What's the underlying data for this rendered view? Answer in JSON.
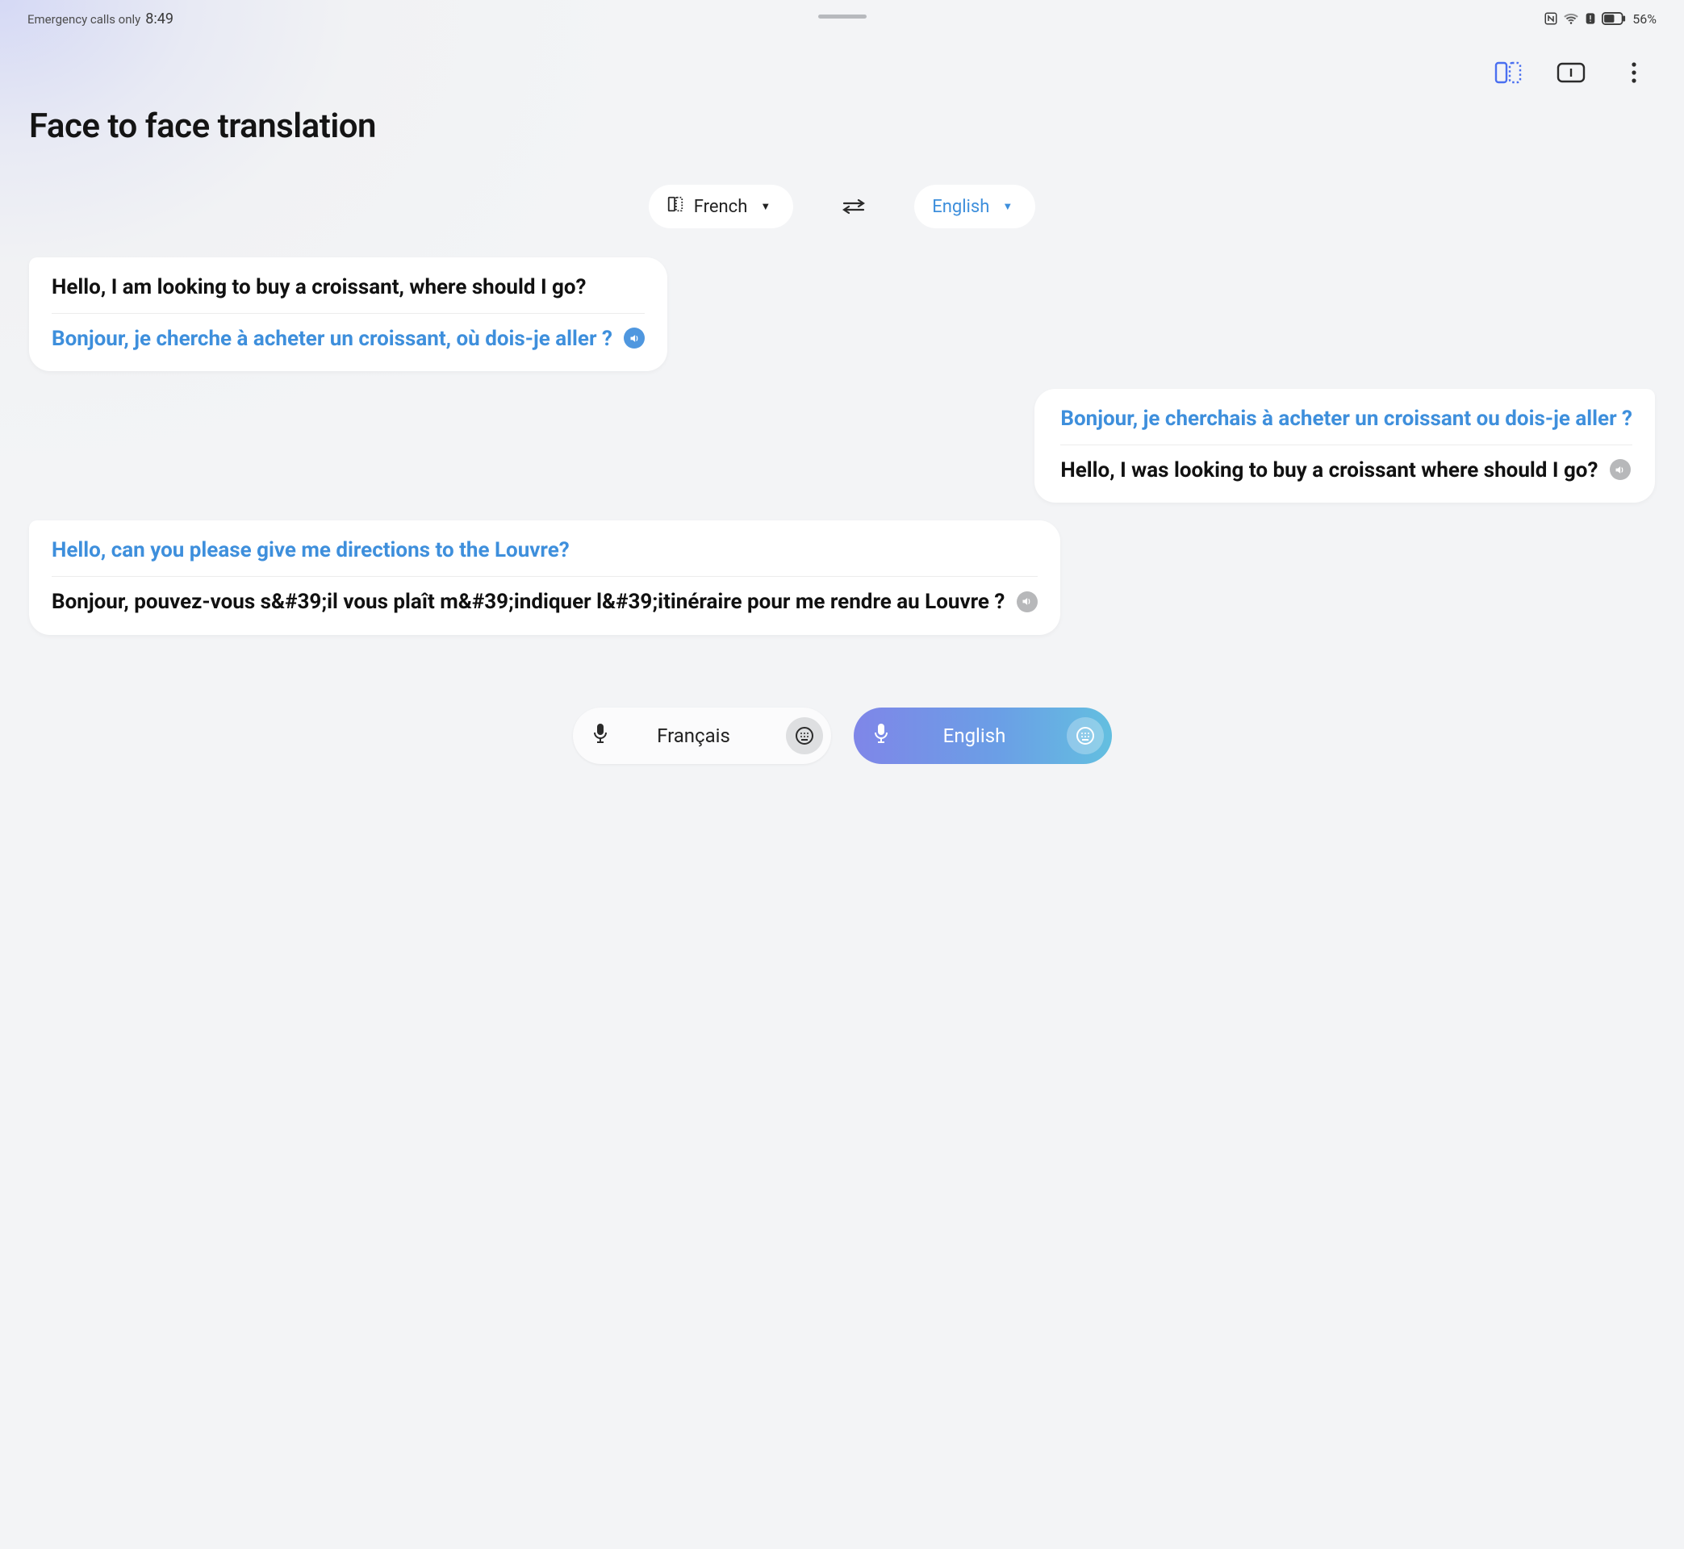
{
  "status": {
    "network_text": "Emergency calls only",
    "time": "8:49",
    "battery_pct": "56%"
  },
  "title": "Face to face translation",
  "lang": {
    "source": "French",
    "target": "English"
  },
  "messages": [
    {
      "side": "left",
      "top": {
        "text": "Hello, I am looking to buy a croissant, where should I go?",
        "color": "black"
      },
      "bottom": {
        "text": "Bonjour, je cherche à acheter un croissant, où dois-je aller ?",
        "color": "blue",
        "speaker": "blue"
      }
    },
    {
      "side": "right",
      "top": {
        "text": "Bonjour, je cherchais à acheter un croissant ou dois-je aller ?",
        "color": "blue"
      },
      "bottom": {
        "text": "Hello, I was looking to buy a croissant where should I go?",
        "color": "black",
        "speaker": "gray"
      }
    },
    {
      "side": "left",
      "top": {
        "text": "Hello, can you please give me directions to the Louvre?",
        "color": "blue"
      },
      "bottom": {
        "text": "Bonjour, pouvez-vous s&#39;il vous plaît m&#39;indiquer l&#39;itinéraire pour me rendre au Louvre ?",
        "color": "black",
        "speaker": "gray"
      }
    }
  ],
  "input": {
    "fr_label": "Français",
    "en_label": "English"
  }
}
